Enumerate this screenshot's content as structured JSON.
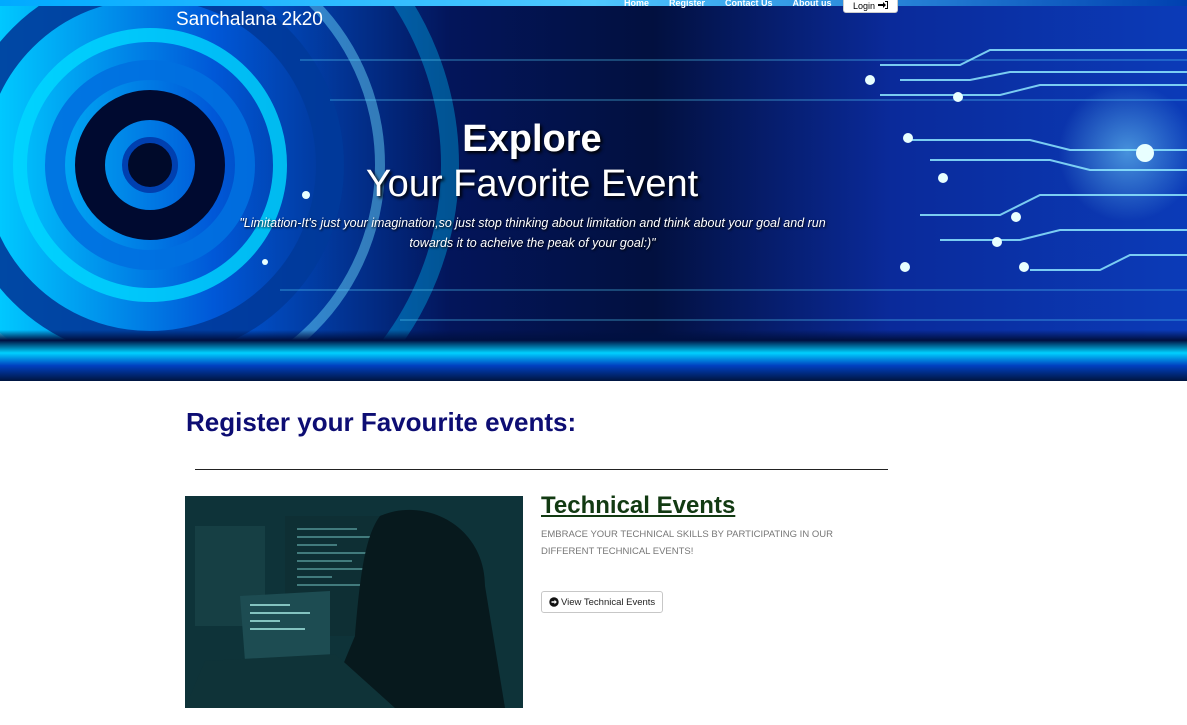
{
  "header": {
    "brand": "Sanchalana 2k20",
    "nav": [
      "Home",
      "Register",
      "Contact Us",
      "About us"
    ],
    "login_label": "Login"
  },
  "hero": {
    "title_line1": "Explore",
    "title_line2": "Your Favorite Event",
    "quote": "\"Limitation-It's just your imagination,so just stop thinking about limitation and think about your goal and run towards it to acheive the peak of your goal:)\""
  },
  "main": {
    "section_title": "Register your Favourite events:",
    "event": {
      "title": "Technical Events",
      "description": "EMBRACE YOUR TECHNICAL SKILLS BY PARTICIPATING IN OUR DIFFERENT TECHNICAL EVENTS!",
      "button_label": "View Technical Events",
      "button_icon": "arrow-circle-right-icon",
      "image_icon": "hacker-laptop-image"
    }
  },
  "colors": {
    "section_title": "#0d0d73",
    "event_title": "#123a12",
    "hero_bg": "#02103f"
  }
}
